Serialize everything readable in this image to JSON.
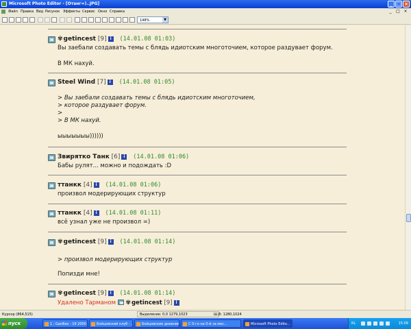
{
  "window": {
    "title": "Microsoft Photo Editor - [Отанг=)..JPG]",
    "minimize": "_",
    "maximize": "□",
    "close": "×"
  },
  "menu": {
    "items": [
      "Файл",
      "Правка",
      "Вид",
      "Рисунок",
      "Эффекты",
      "Сервис",
      "Окно",
      "Справка"
    ]
  },
  "toolbar": {
    "zoom": "148%"
  },
  "posts": [
    {
      "author": "getincest",
      "count": "[9]",
      "timestamp": "(14.01.08 01:03)",
      "lines": [
        "Вы заебали создавать темы с блядь идиотским многоточием, которое раздувает форум.",
        "В МК нахуй."
      ]
    },
    {
      "author": "Steel Wind",
      "count": "[7]",
      "timestamp": "(14.01.08 01:05)",
      "lines": [
        "> Вы заебали создавать темы с блядь идиотским многоточием,",
        "> которое раздувает форум.",
        ">",
        "> В МК нахуй.",
        "ыыыыыыы))))))"
      ]
    },
    {
      "author": "Звирятко Танк",
      "count": "[6]",
      "timestamp": "(14.01.08 01:06)",
      "lines": [
        "Бабы рулят... можно и подождать :D"
      ]
    },
    {
      "author": "ттанкк",
      "count": "[4]",
      "timestamp": "(14.01.08 01:06)",
      "lines": [
        "произвол модерирующих структур"
      ]
    },
    {
      "author": "ттанкк",
      "count": "[4]",
      "timestamp": "(14.01.08 01:11)",
      "lines": [
        "всё узнал уже не произвол =)"
      ]
    },
    {
      "author": "getincest",
      "count": "[9]",
      "timestamp": "(14.01.08 01:14)",
      "lines": [
        "> произвол модерирующих структур",
        "Попизди мне!"
      ]
    },
    {
      "author": "getincest",
      "count": "[9]",
      "timestamp": "(14.01.08 01:14)",
      "deleted_by": "Удалено Тарманом",
      "deleted_author": "getincest",
      "deleted_count": "[9]"
    }
  ],
  "info_icon": "i",
  "status": {
    "cursor": "Курсор (864,515)",
    "selection": "Выделение: 0,0 1279,1023",
    "size": "Ш,В: 1280,1024"
  },
  "taskbar": {
    "start": "пуск",
    "tasks": [
      "1 : GanBas - 19 2000 (...",
      "Бойцовский клуб - ...",
      "Бойцовские дневник...",
      "С 0-го на 0-й за мес...",
      "Microsoft Photo Edito..."
    ],
    "lang": "RL",
    "clock": "15:09"
  }
}
